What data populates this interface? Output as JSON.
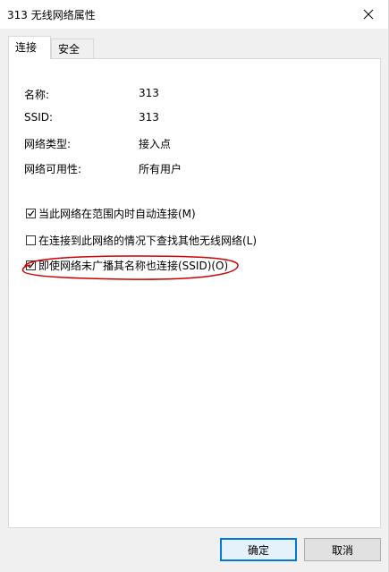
{
  "window": {
    "title": "313 无线网络属性"
  },
  "tabs": [
    {
      "label": "连接",
      "active": true
    },
    {
      "label": "安全",
      "active": false
    }
  ],
  "properties": [
    {
      "label": "名称:",
      "value": "313"
    },
    {
      "label": "SSID:",
      "value": "313"
    },
    {
      "label": "网络类型:",
      "value": "接入点"
    },
    {
      "label": "网络可用性:",
      "value": "所有用户"
    }
  ],
  "checkboxes": [
    {
      "label": "当此网络在范围内时自动连接(M)",
      "checked": true
    },
    {
      "label": "在连接到此网络的情况下查找其他无线网络(L)",
      "checked": false
    },
    {
      "label": "即使网络未广播其名称也连接(SSID)(O)",
      "checked": true
    }
  ],
  "buttons": {
    "ok": "确定",
    "cancel": "取消"
  },
  "colors": {
    "annotation": "#cc0000",
    "focus": "#0078d7"
  }
}
